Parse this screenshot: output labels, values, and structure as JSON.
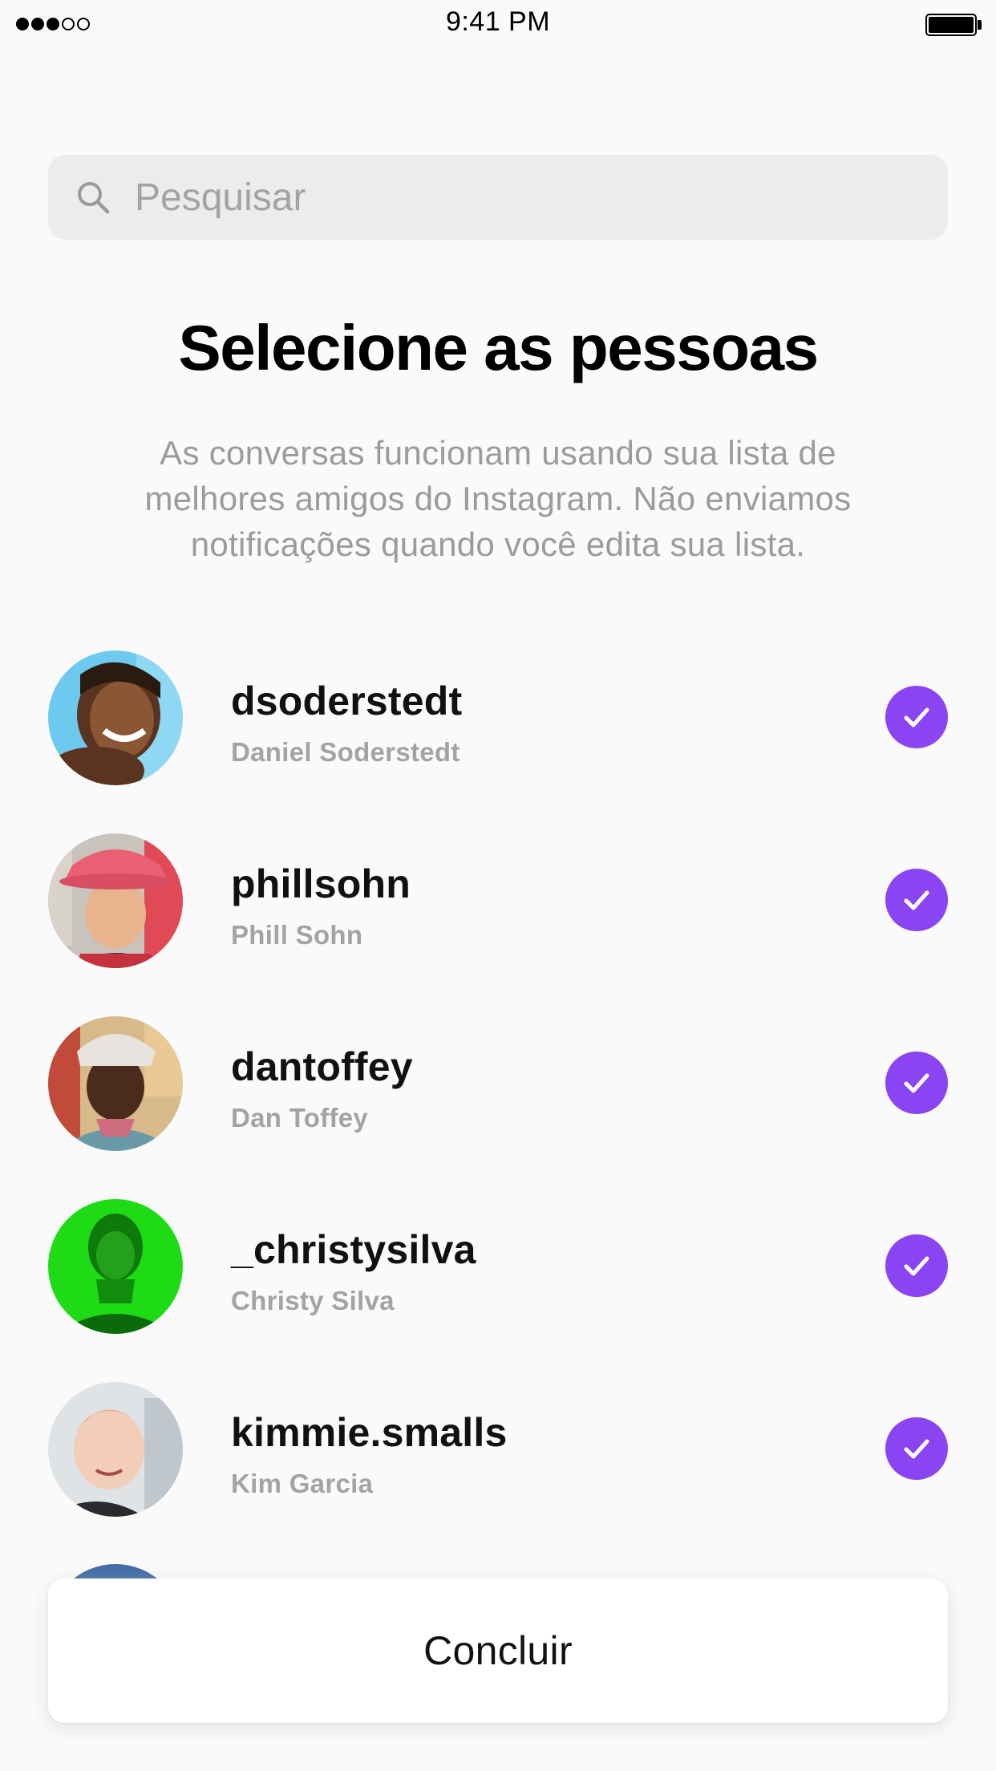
{
  "status_bar": {
    "time": "9:41 PM"
  },
  "search": {
    "placeholder": "Pesquisar",
    "icon": "search-icon"
  },
  "header": {
    "title": "Selecione as pessoas",
    "subtitle": "As conversas funcionam usando sua lista de melhores amigos do Instagram. Não enviamos notificações quando você edita sua lista."
  },
  "people": [
    {
      "username": "dsoderstedt",
      "full_name": "Daniel Soderstedt",
      "selected": true
    },
    {
      "username": "phillsohn",
      "full_name": "Phill Sohn",
      "selected": true
    },
    {
      "username": "dantoffey",
      "full_name": "Dan Toffey",
      "selected": true
    },
    {
      "username": "_christysilva",
      "full_name": "Christy Silva",
      "selected": true
    },
    {
      "username": "kimmie.smalls",
      "full_name": "Kim Garcia",
      "selected": true
    }
  ],
  "done_button": {
    "label": "Concluir"
  },
  "colors": {
    "accent": "#8b44f1",
    "background": "#fafafa",
    "search_bg": "#ececec",
    "secondary_text": "#a3a3a3"
  }
}
